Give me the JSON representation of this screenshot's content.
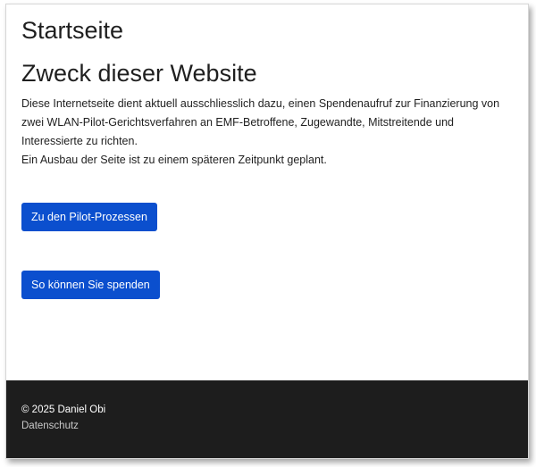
{
  "page": {
    "title": "Startseite",
    "section_title": "Zweck dieser Website",
    "description_lines": [
      "Diese Internetseite dient aktuell ausschliesslich dazu, einen Spendenaufruf zur Finanzierung von",
      "zwei WLAN-Pilot-Gerichtsverfahren an EMF-Betroffene, Zugewandte, Mitstreitende und",
      "Interessierte zu richten.",
      "Ein Ausbau der Seite ist zu einem späteren Zeitpunkt geplant."
    ]
  },
  "buttons": {
    "pilot_label": "Zu den Pilot-Prozessen",
    "donate_label": "So können Sie spenden"
  },
  "footer": {
    "copyright": "© 2025 Daniel Obi",
    "privacy_link": "Datenschutz"
  },
  "colors": {
    "button_bg": "#0b4fce",
    "footer_bg": "#1d1d1d"
  }
}
